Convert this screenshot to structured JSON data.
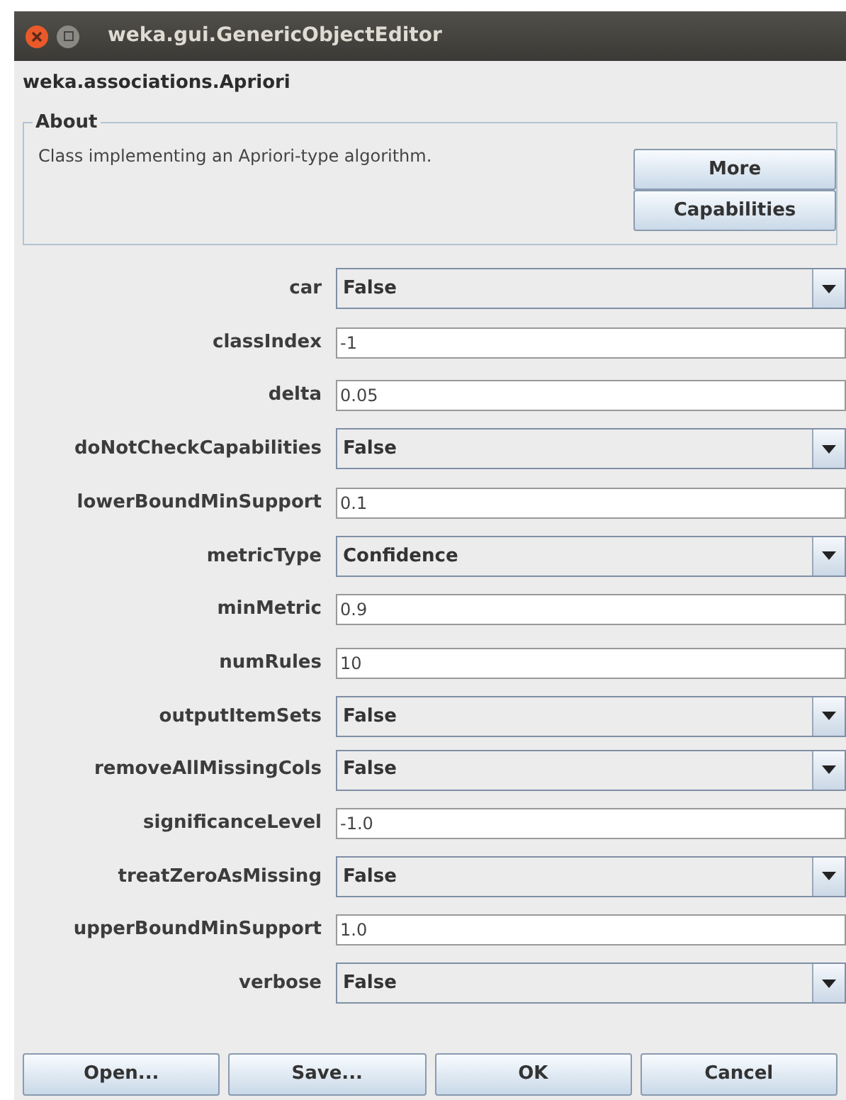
{
  "window": {
    "title": "weka.gui.GenericObjectEditor"
  },
  "class_name": "weka.associations.Apriori",
  "about": {
    "title": "About",
    "text": "Class implementing an Apriori-type algorithm.",
    "buttons": [
      "More",
      "Capabilities"
    ]
  },
  "properties": [
    {
      "label": "car",
      "kind": "combo",
      "value": "False"
    },
    {
      "label": "classIndex",
      "kind": "text",
      "value": "-1"
    },
    {
      "label": "delta",
      "kind": "text",
      "value": "0.05"
    },
    {
      "label": "doNotCheckCapabilities",
      "kind": "combo",
      "value": "False"
    },
    {
      "label": "lowerBoundMinSupport",
      "kind": "text",
      "value": "0.1"
    },
    {
      "label": "metricType",
      "kind": "combo",
      "value": "Confidence"
    },
    {
      "label": "minMetric",
      "kind": "text",
      "value": "0.9"
    },
    {
      "label": "numRules",
      "kind": "text",
      "value": "10"
    },
    {
      "label": "outputItemSets",
      "kind": "combo",
      "value": "False"
    },
    {
      "label": "removeAllMissingCols",
      "kind": "combo",
      "value": "False"
    },
    {
      "label": "significanceLevel",
      "kind": "text",
      "value": "-1.0"
    },
    {
      "label": "treatZeroAsMissing",
      "kind": "combo",
      "value": "False"
    },
    {
      "label": "upperBoundMinSupport",
      "kind": "text",
      "value": "1.0"
    },
    {
      "label": "verbose",
      "kind": "combo",
      "value": "False"
    }
  ],
  "buttons": [
    "Open...",
    "Save...",
    "OK",
    "Cancel"
  ]
}
